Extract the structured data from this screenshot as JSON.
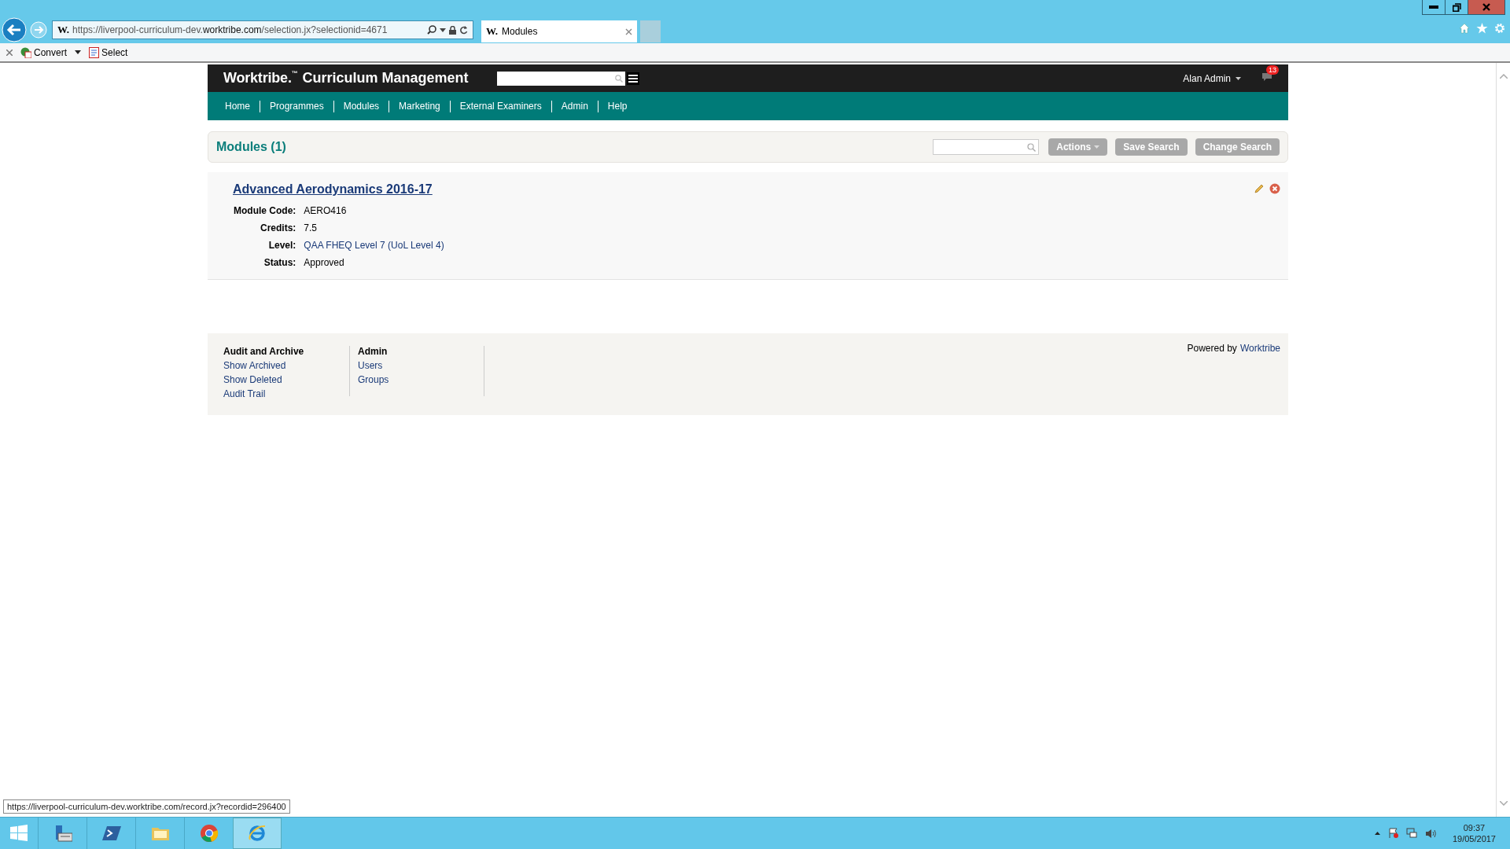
{
  "browser": {
    "favicon": "W.",
    "address": "https://liverpool-curriculum-dev.**worktribe.com**/selection.jx?selectionid=4671",
    "tabs": [
      {
        "favicon": "W.",
        "title": "Modules",
        "selected": true
      }
    ],
    "commands": [
      {
        "kind": "convert",
        "label": "Convert"
      },
      {
        "kind": "select",
        "label": "Select"
      }
    ]
  },
  "app": {
    "brand": "Worktribe.",
    "trademark": "™",
    "product": "Curriculum Management",
    "user": "Alan Admin",
    "notifications": "13",
    "nav": [
      "Home",
      "Programmes",
      "Modules",
      "Marketing",
      "External Examiners",
      "Admin",
      "Help"
    ]
  },
  "results": {
    "title": "Modules (1)",
    "buttons": [
      {
        "label": "Actions",
        "kind": "dropdown"
      },
      {
        "label": "Save Search",
        "kind": "plain"
      },
      {
        "label": "Change Search",
        "kind": "plain"
      }
    ]
  },
  "record": {
    "title": "Advanced Aerodynamics 2016-17",
    "fields": [
      {
        "label": "Module Code:",
        "value": "AERO416",
        "kind": "text"
      },
      {
        "label": "Credits:",
        "value": "7.5",
        "kind": "text"
      },
      {
        "label": "Level:",
        "value": "QAA FHEQ Level 7 (UoL Level 4)",
        "kind": "link"
      },
      {
        "label": "Status:",
        "value": "Approved",
        "kind": "text"
      }
    ]
  },
  "footer": {
    "columns": [
      {
        "heading": "Audit and Archive",
        "links": [
          "Show Archived",
          "Show Deleted",
          "Audit Trail"
        ]
      },
      {
        "heading": "Admin",
        "links": [
          "Users",
          "Groups"
        ]
      }
    ],
    "powered_by": "Powered by",
    "powered_link": "Worktribe"
  },
  "status_url": "https://liverpool-curriculum-dev.worktribe.com/record.jx?recordid=296400",
  "taskbar": {
    "apps": [
      {
        "kind": "server",
        "selected": false
      },
      {
        "kind": "powershell",
        "selected": false
      },
      {
        "kind": "folder",
        "selected": false
      },
      {
        "kind": "chrome",
        "selected": false
      },
      {
        "kind": "ie",
        "selected": true
      }
    ],
    "time": "09:37",
    "date": "19/05/2017"
  }
}
